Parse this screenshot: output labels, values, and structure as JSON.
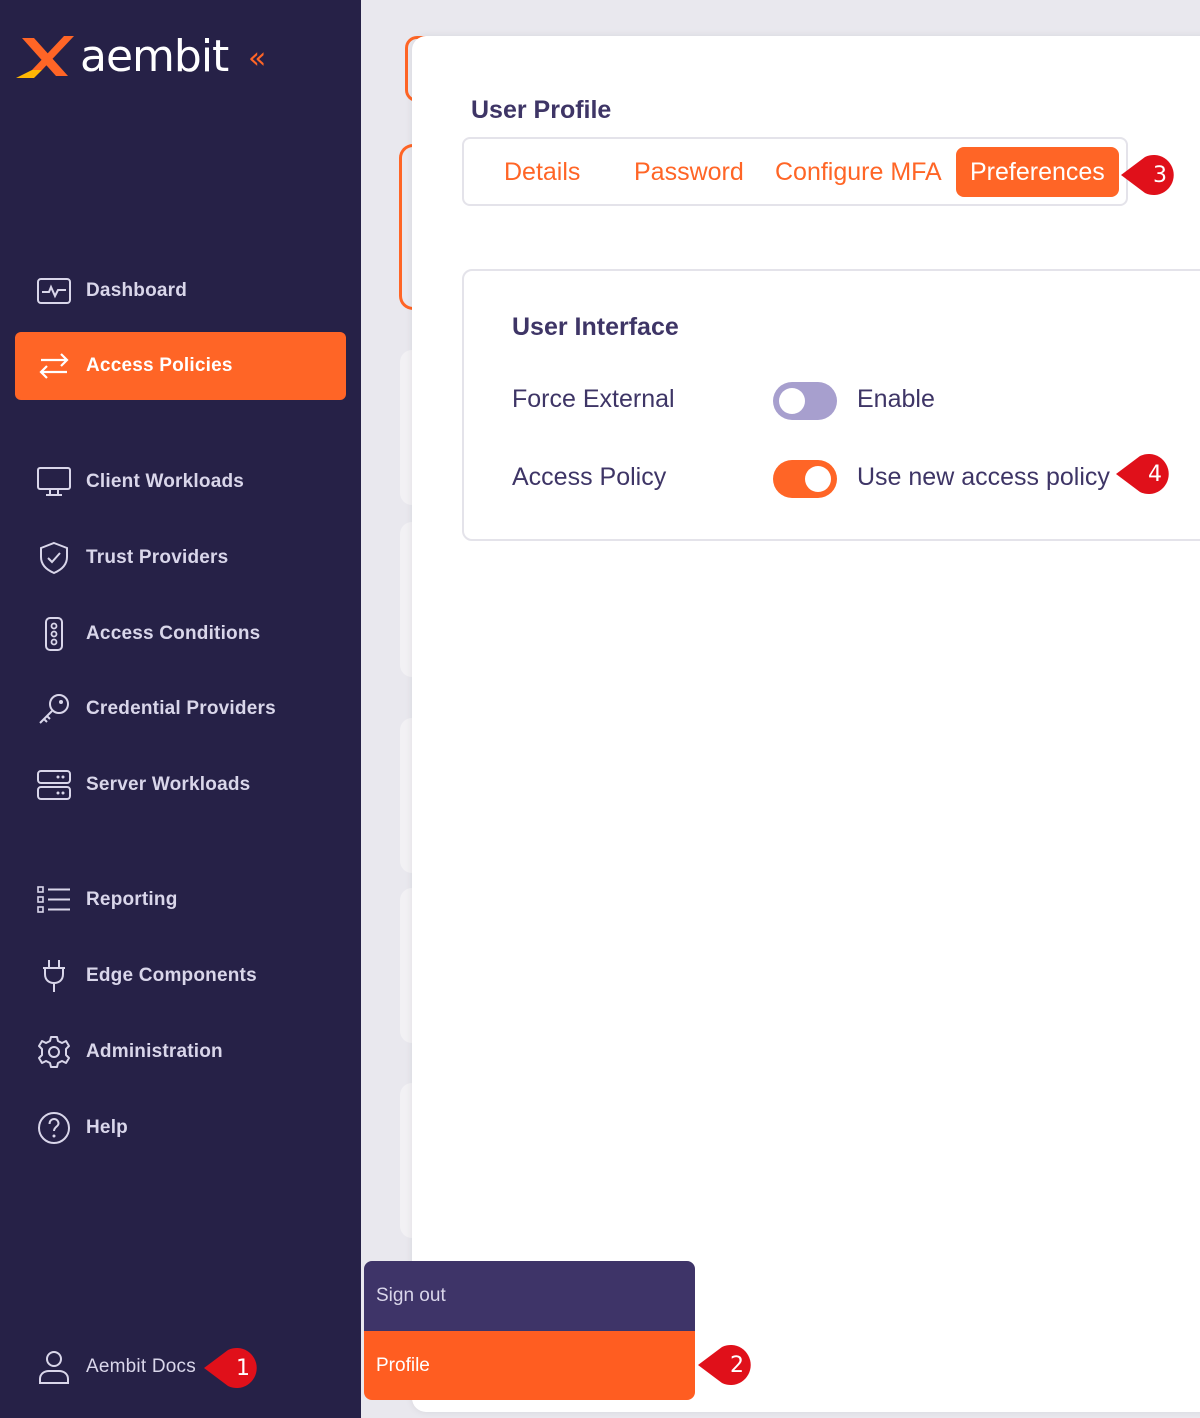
{
  "app": {
    "name": "aembit"
  },
  "sidebar": {
    "collapse_icon": "double-chevron-left-icon",
    "items": [
      {
        "label": "Dashboard",
        "icon": "dashboard-icon"
      },
      {
        "label": "Access Policies",
        "icon": "arrows-exchange-icon",
        "active": true
      },
      {
        "label": "Client Workloads",
        "icon": "monitor-icon"
      },
      {
        "label": "Trust Providers",
        "icon": "shield-check-icon"
      },
      {
        "label": "Access Conditions",
        "icon": "traffic-light-icon"
      },
      {
        "label": "Credential Providers",
        "icon": "key-icon"
      },
      {
        "label": "Server Workloads",
        "icon": "server-icon"
      },
      {
        "label": "Reporting",
        "icon": "list-icon"
      },
      {
        "label": "Edge Components",
        "icon": "plug-icon"
      },
      {
        "label": "Administration",
        "icon": "gear-icon"
      },
      {
        "label": "Help",
        "icon": "help-icon"
      }
    ],
    "user": {
      "label": "Aembit Docs",
      "icon": "user-icon"
    }
  },
  "dialog": {
    "title": "User Profile",
    "tabs": [
      {
        "label": "Details"
      },
      {
        "label": "Password"
      },
      {
        "label": "Configure MFA"
      },
      {
        "label": "Preferences",
        "active": true
      }
    ],
    "section": {
      "title": "User Interface",
      "rows": [
        {
          "label": "Force External",
          "toggle_on": false,
          "toggle_text": "Enable"
        },
        {
          "label": "Access Policy",
          "toggle_on": true,
          "toggle_text": "Use new access policy"
        }
      ]
    }
  },
  "user_menu": {
    "items": [
      {
        "label": "Sign out"
      },
      {
        "label": "Profile",
        "active": true
      }
    ]
  },
  "callouts": [
    "1",
    "2",
    "3",
    "4"
  ],
  "colors": {
    "sidebar_bg": "#262147",
    "accent": "#ff6526",
    "text_dark": "#3e3566",
    "callout_red": "#e0101a"
  }
}
